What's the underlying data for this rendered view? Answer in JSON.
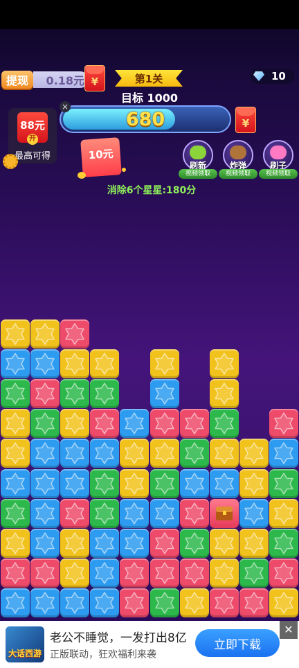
{
  "header": {
    "cashout_label": "提现",
    "cash_value": "0.18元",
    "yuan_symbol": "¥",
    "level_label": "第1关",
    "target_label": "目标 1000",
    "gem_count": "10",
    "score": "680",
    "score_progress": 0.68,
    "close_symbol": "×"
  },
  "max_reward": {
    "amount": "88元",
    "open": "开",
    "label": "最高可得"
  },
  "red_packet": {
    "amount": "10元"
  },
  "powerups": [
    {
      "name": "刷新",
      "tag": "视频领取"
    },
    {
      "name": "炸弹",
      "tag": "视频领取"
    },
    {
      "name": "刷子",
      "tag": "视频领取"
    }
  ],
  "hint": "消除6个星星:180分",
  "colors": {
    "Y": "#f2c21c",
    "B": "#2d9cf0",
    "G": "#2cb84a",
    "P": "#ee4a6a"
  },
  "board": [
    "YYP.......",
    "BBYY.Y.Y..",
    "GPGG.B.Y..",
    "YGYPBPPG.P",
    "YBBBYYGYYB",
    "BBBGYGBBYG",
    "GBPGBBPTBY",
    "YBYBBPGYYG",
    "PPYBPPPYGP",
    "BBBBPGYPPY"
  ],
  "ad": {
    "app_name": "大话西游",
    "title": "老公不睡觉，一发打出8亿",
    "subtitle": "正版联动，狂欢福利来袭",
    "download": "立即下载",
    "close": "✕"
  }
}
